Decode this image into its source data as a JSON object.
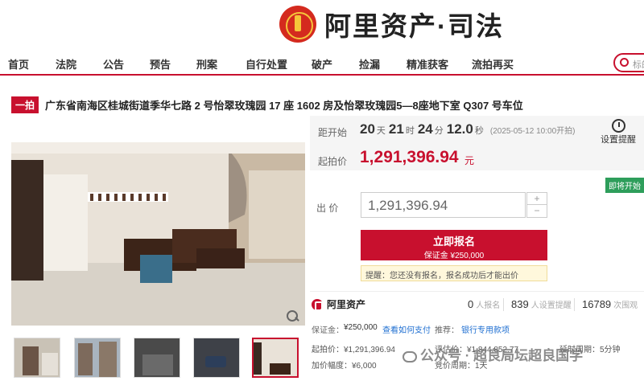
{
  "header": {
    "logo_text": "阿里资产·司法"
  },
  "nav": {
    "items": [
      "首页",
      "法院",
      "公告",
      "预告",
      "刑案",
      "自行处置",
      "破产",
      "捡漏",
      "精准获客",
      "流拍再买"
    ],
    "search_placeholder": "标的"
  },
  "item": {
    "round_badge": "一拍",
    "title": "广东省南海区桂城街道季华七路 2 号怡翠玫瑰园 17 座 1602 房及怡翠玫瑰园5—8座地下室 Q307 号车位"
  },
  "auction": {
    "countdown_label": "距开始",
    "days": "20",
    "days_unit": "天",
    "hours": "21",
    "hours_unit": "时",
    "minutes": "24",
    "minutes_unit": "分",
    "seconds": "12.0",
    "seconds_unit": "秒",
    "start_time": "(2025-05-12 10:00开拍)",
    "start_price_label": "起拍价",
    "start_price": "1,291,396.94",
    "price_unit": "元",
    "remind_label": "设置提醒",
    "status_badge": "即将开始",
    "bid_label": "出 价",
    "bid_value": "1,291,396.94",
    "register_label": "立即报名",
    "deposit_sub": "保证金 ¥250,000",
    "tip": "提醒：您还没有报名，报名成功后才能出价"
  },
  "stats": {
    "brand": "阿里资产",
    "signups": "0",
    "signups_label": "人报名",
    "reminders": "839",
    "reminders_label": "人设置提醒",
    "views": "16789",
    "views_label": "次围观"
  },
  "details": {
    "deposit_label": "保证金：",
    "deposit_value": "¥250,000",
    "deposit_link": "查看如何支付",
    "recommend_label": "推荐：",
    "recommend_link": "银行专用款项",
    "start_price_label": "起拍价：",
    "start_price_value": "¥1,291,396.94",
    "appraisal_label": "评估价：",
    "appraisal_value": "¥1,844,852.77",
    "delay_label": "延时周期：",
    "delay_value": "5分钟",
    "increment_label": "加价幅度：",
    "increment_value": "¥6,000",
    "bid_period_label": "竞价周期：",
    "bid_period_value": "1天"
  },
  "watermark": "公众号 · 超良局坛超良国学",
  "colors": {
    "accent": "#c8102e",
    "green": "#2e9e5b",
    "link": "#1f6fd1"
  }
}
